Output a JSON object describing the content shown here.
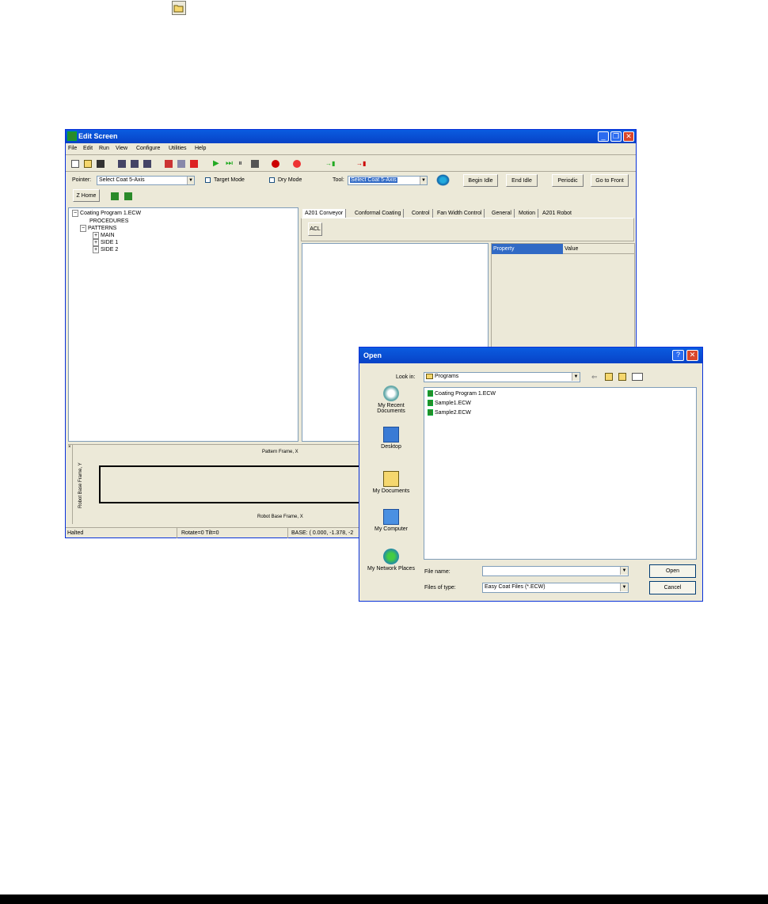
{
  "edit_screen": {
    "title": "Edit Screen",
    "menu": [
      "File",
      "Edit",
      "Run",
      "View",
      "Configure",
      "Utilities",
      "Help"
    ],
    "pointer_label": "Pointer:",
    "pointer_value": "Select Coat 5-Axis",
    "target_mode_label": "Target Mode",
    "dry_mode_label": "Dry Mode",
    "tool_label": "Tool:",
    "tool_value": "Select Coat 5-Axis",
    "begin_idle": "Begin Idle",
    "end_idle": "End Idle",
    "periodic": "Periodic",
    "go_to_front": "Go to Front",
    "z_home": "Z Home",
    "tree": {
      "root": "Coating Program 1.ECW",
      "procedures": "PROCEDURES",
      "patterns": "PATTERNS",
      "main": "MAIN",
      "side1": "SIDE 1",
      "side2": "SIDE 2"
    },
    "tabs": [
      "A201 Conveyor",
      "Conformal Coating",
      "Control",
      "Fan Width Control",
      "General",
      "Motion",
      "A201 Robot"
    ],
    "acl_button": "ACL",
    "property_header": "Property",
    "value_header": "Value",
    "plot": {
      "top_label": "Pattern Frame, X",
      "side_label": "Robot Base Frame, Y",
      "bottom_label": "Robot Base Frame, X"
    },
    "status": {
      "state": "Halted",
      "rotate_tilt": "Rotate=0 Tilt=0",
      "base": "BASE: ( 0.000, -1.378, -2"
    }
  },
  "open_dialog": {
    "title": "Open",
    "look_in_label": "Look in:",
    "look_in_value": "Programs",
    "places": [
      "My Recent Documents",
      "Desktop",
      "My Documents",
      "My Computer",
      "My Network Places"
    ],
    "files": [
      "Coating Program 1.ECW",
      "Sample1.ECW",
      "Sample2.ECW"
    ],
    "file_name_label": "File name:",
    "file_name_value": "",
    "files_of_type_label": "Files of type:",
    "files_of_type_value": "Easy Coat Files (*.ECW)",
    "open_button": "Open",
    "cancel_button": "Cancel"
  },
  "colors": {
    "title_blue": "#0842c6",
    "window_face": "#ece9d8",
    "selection": "#316ac5",
    "close_red": "#d9472b"
  }
}
